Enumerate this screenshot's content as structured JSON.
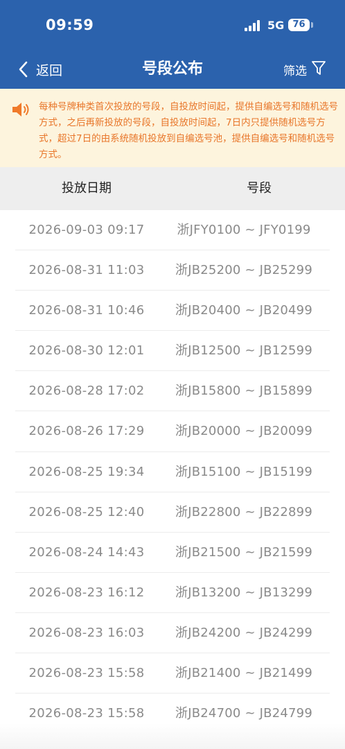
{
  "status_bar": {
    "time": "09:59",
    "network": "5G",
    "battery": "76"
  },
  "header": {
    "back_label": "返回",
    "title": "号段公布",
    "filter_label": "筛选"
  },
  "notice": {
    "text": "每种号牌种类首次投放的号段，自投放时间起，提供自编选号和随机选号方式，之后再新投放的号段，自投放时间起，7日内只提供随机选号方式，超过7日的由系统随机投放到自编选号池，提供自编选号和随机选号方式。"
  },
  "table": {
    "columns": [
      "投放日期",
      "号段"
    ],
    "rows": [
      {
        "date": "2026-09-03 09:17",
        "segment": "浙JFY0100 ~ JFY0199"
      },
      {
        "date": "2026-08-31 11:03",
        "segment": "浙JB25200 ~ JB25299"
      },
      {
        "date": "2026-08-31 10:46",
        "segment": "浙JB20400 ~ JB20499"
      },
      {
        "date": "2026-08-30 12:01",
        "segment": "浙JB12500 ~ JB12599"
      },
      {
        "date": "2026-08-28 17:02",
        "segment": "浙JB15800 ~ JB15899"
      },
      {
        "date": "2026-08-26 17:29",
        "segment": "浙JB20000 ~ JB20099"
      },
      {
        "date": "2026-08-25 19:34",
        "segment": "浙JB15100 ~ JB15199"
      },
      {
        "date": "2026-08-25 12:40",
        "segment": "浙JB22800 ~ JB22899"
      },
      {
        "date": "2026-08-24 14:43",
        "segment": "浙JB21500 ~ JB21599"
      },
      {
        "date": "2026-08-23 16:12",
        "segment": "浙JB13200 ~ JB13299"
      },
      {
        "date": "2026-08-23 16:03",
        "segment": "浙JB24200 ~ JB24299"
      },
      {
        "date": "2026-08-23 15:58",
        "segment": "浙JB21400 ~ JB21499"
      },
      {
        "date": "2026-08-23 15:58",
        "segment": "浙JB24700 ~ JB24799"
      }
    ]
  },
  "colors": {
    "header_bg": "#2b62ad",
    "notice_bg": "#fdf4dd",
    "notice_text": "#e8762a",
    "table_head_bg": "#eeeeee",
    "row_text": "#8a8a8a"
  },
  "icons": [
    "signal-icon",
    "battery-icon",
    "back-chevron-icon",
    "filter-funnel-icon",
    "speaker-icon"
  ]
}
